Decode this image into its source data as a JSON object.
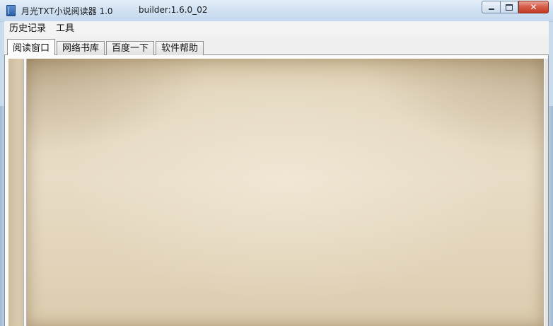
{
  "window": {
    "title": "月光TXT小说阅读器 1.0",
    "build": "builder:1.6.0_02",
    "icon": "book-icon",
    "caption_buttons": {
      "minimize": "minimize-icon",
      "maximize": "maximize-icon",
      "close_label": "✕"
    }
  },
  "menubar": {
    "items": [
      {
        "label": "历史记录"
      },
      {
        "label": "工具"
      }
    ]
  },
  "tabs": [
    {
      "label": "阅读窗口",
      "active": true
    },
    {
      "label": "网络书库",
      "active": false
    },
    {
      "label": "百度一下",
      "active": false
    },
    {
      "label": "软件帮助",
      "active": false
    }
  ],
  "colors": {
    "paper": "#e3d6bd",
    "titlebar": "#d2e2f3",
    "close_button": "#d7604c"
  }
}
